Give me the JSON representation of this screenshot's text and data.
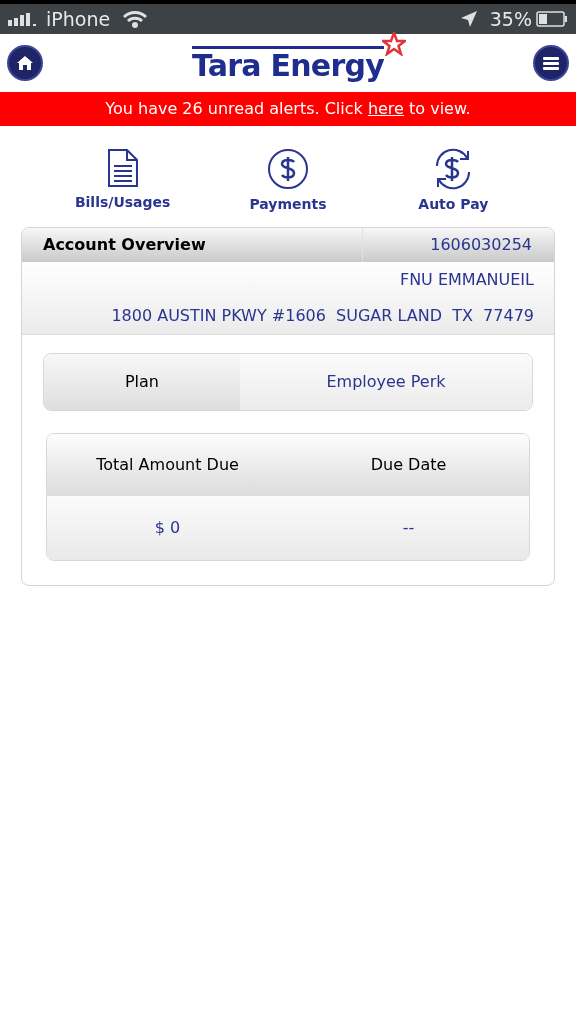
{
  "status_bar": {
    "carrier": "iPhone",
    "battery": "35%"
  },
  "header": {
    "logo": "Tara Energy"
  },
  "alert": {
    "before": "You have 26 unread alerts. Click ",
    "link": "here",
    "after": " to view."
  },
  "shortcuts": [
    {
      "kind": "document",
      "label": "Bills/Usages"
    },
    {
      "kind": "dollar",
      "label": "Payments"
    },
    {
      "kind": "autopay",
      "label": "Auto Pay"
    }
  ],
  "account": {
    "title": "Account Overview",
    "number": "1606030254",
    "name": "FNU EMMANUEIL",
    "address": "1800 AUSTIN PKWY #1606  SUGAR LAND  TX  77479"
  },
  "plan": {
    "label": "Plan",
    "value": "Employee Perk"
  },
  "due": {
    "columns": [
      "Total Amount Due",
      "Due Date"
    ],
    "values": [
      "$ 0",
      "--"
    ]
  }
}
